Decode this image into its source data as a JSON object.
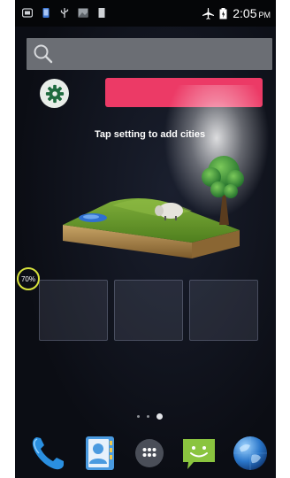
{
  "status_bar": {
    "time": "2:05",
    "ampm": "PM",
    "left_icons": [
      "notification-icon",
      "phone-icon",
      "usb-icon",
      "image-icon",
      "sd-card-icon"
    ],
    "right_icons": [
      "airplane-mode-icon",
      "battery-icon"
    ]
  },
  "search": {
    "icon": "search-icon"
  },
  "weather_widget": {
    "settings_icon": "gear-icon",
    "prompt": "Tap setting to add cities",
    "accent_color": "#ec3a66"
  },
  "battery_gauge": {
    "level_text": "70%",
    "level_fraction": 0.7
  },
  "widget_slots": [
    "empty",
    "empty",
    "empty"
  ],
  "page_indicator": {
    "pages": 3,
    "active_page": 3
  },
  "dock": {
    "apps": [
      "phone-icon",
      "contacts-icon",
      "app-drawer-icon",
      "messaging-icon",
      "browser-globe-icon"
    ]
  }
}
